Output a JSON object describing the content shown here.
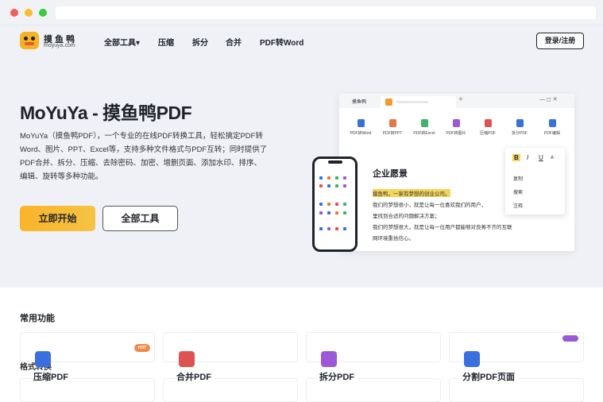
{
  "brand": {
    "name": "摸鱼鸭",
    "domain": "moyuya.com"
  },
  "nav": [
    "全部工具▾",
    "压缩",
    "拆分",
    "合并",
    "PDF转Word"
  ],
  "header": {
    "login_label": "登录/注册"
  },
  "hero": {
    "title": "MoYuYa - 摸鱼鸭PDF",
    "description": "MoYuYa（摸鱼鸭PDF），一个专业的在线PDF转换工具，轻松搞定PDF转 Word、图片、PPT、Excel等，支持多种文件格式与PDF互转；同时提供了PDF合并、拆分、压缩、去除密码、加密、增删页面、添加水印、排序、编辑、旋转等多种功能。",
    "start_button": "立即开始",
    "all_tools_button": "全部工具"
  },
  "mockup": {
    "tab_label": "摸鱼鸭",
    "tools": [
      {
        "label": "PDF转Word",
        "color": "#3a6fe0"
      },
      {
        "label": "PDF转PPT",
        "color": "#e6764a"
      },
      {
        "label": "PDF转Excel",
        "color": "#3fb26b"
      },
      {
        "label": "PDF转图片",
        "color": "#9b59d8"
      },
      {
        "label": "压缩PDF",
        "color": "#e05252"
      },
      {
        "label": "拆分PDF",
        "color": "#3a6fe0"
      },
      {
        "label": "PDF编辑",
        "color": "#3a6fe0"
      }
    ],
    "doc_title": "企业愿景",
    "doc_highlight": "摸鱼鸭，一家有梦想的创业公司。",
    "doc_lines": [
      "我们的梦想很小，就是让每一位喜欢我们的用户，",
      "里找到合适的问题解决方案；",
      "我们的梦想很大，就是让每一位用户都能够对良莠不齐的互联",
      "网环境重拾信心。"
    ],
    "context_menu": [
      "复制",
      "搜索",
      "注释"
    ]
  },
  "features": {
    "section_title": "常用功能",
    "overlap_text": "格式转换",
    "hot_badge": "HOT",
    "items": [
      {
        "label": "压缩PDF",
        "color": "#3a6fe0"
      },
      {
        "label": "合并PDF",
        "color": "#e05252"
      },
      {
        "label": "拆分PDF",
        "color": "#9b59d8"
      },
      {
        "label": "分割PDF页面",
        "color": "#3a6fe0"
      }
    ]
  }
}
